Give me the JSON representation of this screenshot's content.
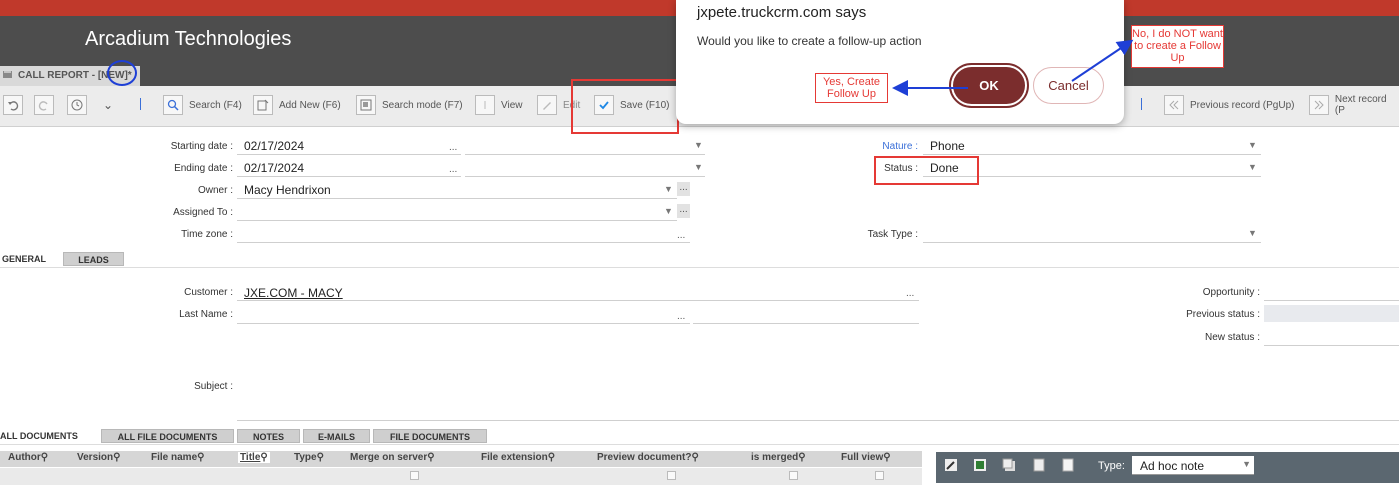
{
  "header": {
    "app_title": "Arcadium Technologies",
    "breadcrumb": "CALL REPORT - [NEW]*"
  },
  "toolbar": {
    "search": "Search (F4)",
    "add_new": "Add New (F6)",
    "search_mode": "Search mode (F7)",
    "view": "View",
    "edit": "Edit",
    "save": "Save (F10)",
    "previous": "Previous record (PgUp)",
    "next": "Next record (P"
  },
  "form": {
    "starting_date_label": "Starting date :",
    "starting_date": "02/17/2024",
    "ending_date_label": "Ending date :",
    "ending_date": "02/17/2024",
    "owner_label": "Owner :",
    "owner": "Macy Hendrixon",
    "assigned_label": "Assigned To :",
    "timezone_label": "Time zone :",
    "nature_label": "Nature :",
    "nature": "Phone",
    "status_label": "Status :",
    "status": "Done",
    "tasktype_label": "Task Type :",
    "dots": "..."
  },
  "tabs": {
    "general": "GENERAL",
    "leads": "LEADS"
  },
  "general": {
    "customer_label": "Customer :",
    "customer": "JXE.COM - MACY",
    "lastname_label": "Last Name :",
    "subject_label": "Subject :",
    "opportunity_label": "Opportunity :",
    "prev_status_label": "Previous status :",
    "new_status_label": "New status :"
  },
  "doc_tabs": [
    "ALL DOCUMENTS",
    "ALL FILE DOCUMENTS",
    "NOTES",
    "E-MAILS",
    "FILE DOCUMENTS"
  ],
  "grid_columns": [
    "Author",
    "Version",
    "File name",
    "Title",
    "Type",
    "Merge on server",
    "File extension",
    "Preview document?",
    "is merged",
    "Full view"
  ],
  "notes": {
    "type_label": "Type:",
    "type_value": "Ad hoc note"
  },
  "dialog": {
    "title": "jxpete.truckcrm.com says",
    "message": "Would you like to create a follow-up action",
    "ok": "OK",
    "cancel": "Cancel"
  },
  "annotations": {
    "yes": "Yes, Create Follow Up",
    "no": "No, I do NOT want to create a Follow Up"
  },
  "colors": {
    "ok_button": "#7b2d2d",
    "annotation": "#e53935",
    "arrow": "#1e3fd6"
  }
}
